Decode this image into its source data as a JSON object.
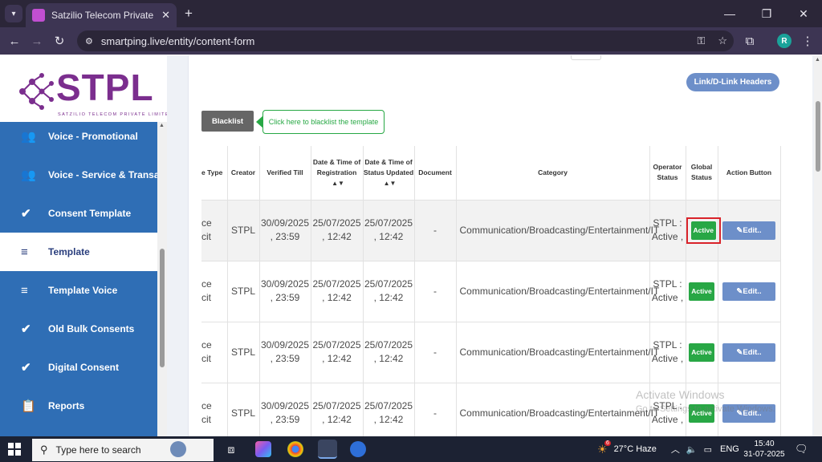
{
  "browser": {
    "tab_title": "Satzilio Telecom Private Limited",
    "url": "smartping.live/entity/content-form",
    "profile_initial": "R"
  },
  "sidebar": {
    "logo_text": "STPL",
    "logo_subtext": "SATZILIO TELECOM PRIVATE LIMITED",
    "items": [
      {
        "label": "Voice - Promotional",
        "icon": "voice-icon"
      },
      {
        "label": "Voice - Service & Transac",
        "icon": "voice-icon"
      },
      {
        "label": "Consent Template",
        "icon": "check-circle-icon"
      },
      {
        "label": "Template",
        "icon": "list-icon",
        "active": true
      },
      {
        "label": "Template Voice",
        "icon": "list-icon"
      },
      {
        "label": "Old Bulk Consents",
        "icon": "check-circle-icon"
      },
      {
        "label": "Digital Consent",
        "icon": "check-circle-icon"
      },
      {
        "label": "Reports",
        "icon": "clipboard-icon"
      }
    ]
  },
  "main": {
    "header_button": "Link/D-Link Headers",
    "blacklist_button": "Blacklist",
    "tooltip": "Click here to blacklist the template",
    "columns": [
      "e Type",
      "Creator",
      "Verified Till",
      "Date & Time of Registration",
      "Date & Time of Status Updated",
      "Document",
      "Category",
      "Operator Status",
      "Global Status",
      "Action Button"
    ],
    "rows": [
      {
        "type": "ce\ncit",
        "creator": "STPL",
        "verified_till": "30/09/2025\n, 23:59",
        "registered": "25/07/2025\n, 12:42",
        "updated": "25/07/2025\n, 12:42",
        "document": "-",
        "category": "Communication/Broadcasting/Entertainment/IT",
        "operator_status": "STPL :\nActive ,",
        "global_status": "Active",
        "action": "Edit.."
      },
      {
        "type": "ce\ncit",
        "creator": "STPL",
        "verified_till": "30/09/2025\n, 23:59",
        "registered": "25/07/2025\n, 12:42",
        "updated": "25/07/2025\n, 12:42",
        "document": "-",
        "category": "Communication/Broadcasting/Entertainment/IT",
        "operator_status": "STPL :\nActive ,",
        "global_status": "Active",
        "action": "Edit.."
      },
      {
        "type": "ce\ncit",
        "creator": "STPL",
        "verified_till": "30/09/2025\n, 23:59",
        "registered": "25/07/2025\n, 12:42",
        "updated": "25/07/2025\n, 12:42",
        "document": "-",
        "category": "Communication/Broadcasting/Entertainment/IT",
        "operator_status": "STPL :\nActive ,",
        "global_status": "Active",
        "action": "Edit.."
      },
      {
        "type": "ce\ncit",
        "creator": "STPL",
        "verified_till": "30/09/2025\n, 23:59",
        "registered": "25/07/2025\n, 12:42",
        "updated": "25/07/2025\n, 12:42",
        "document": "-",
        "category": "Communication/Broadcasting/Entertainment/IT",
        "operator_status": "STPL :\nActive ,",
        "global_status": "Active",
        "action": "Edit.."
      }
    ]
  },
  "watermark": {
    "line1": "Activate Windows",
    "line2": "Go to Settings to activate Windows."
  },
  "taskbar": {
    "search_placeholder": "Type here to search",
    "weather": "27°C  Haze",
    "language": "ENG",
    "time": "15:40",
    "date": "31-07-2025",
    "weather_badge": "6"
  },
  "colors": {
    "sidebar_blue": "#2f6eb5",
    "button_blue": "#6d8fc9",
    "active_green": "#28a745",
    "highlight_red": "#d9232a",
    "brand_purple": "#7b2e8e"
  }
}
